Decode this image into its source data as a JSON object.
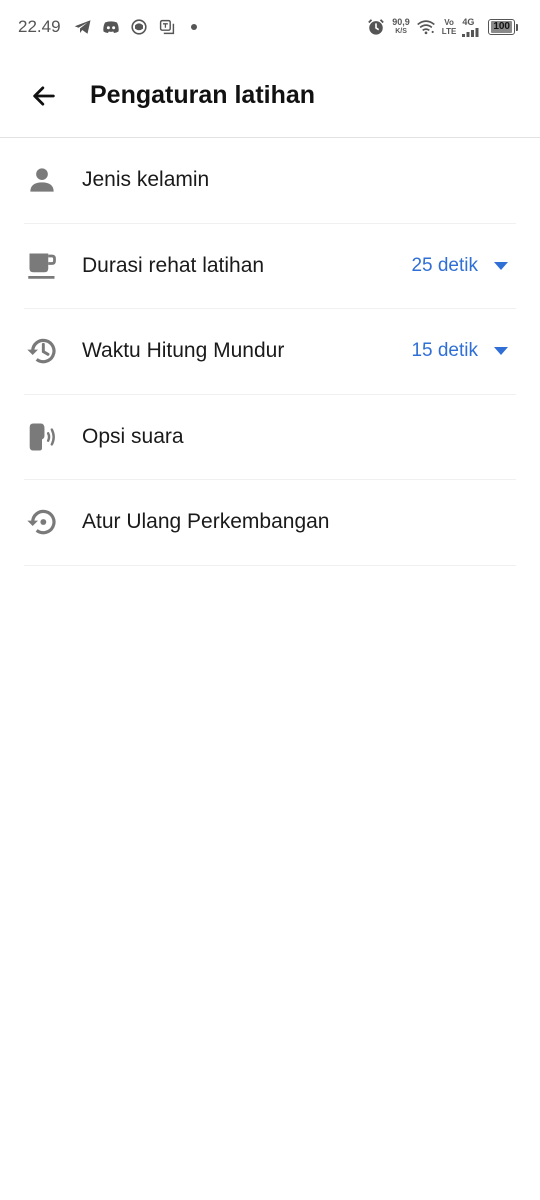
{
  "status_bar": {
    "time": "22.49",
    "net_speed_value": "90,9",
    "net_speed_unit": "K/S",
    "volte_top": "Vo",
    "volte_bottom": "LTE",
    "network_type": "4G",
    "battery": "100",
    "left_icons": [
      "telegram-icon",
      "discord-icon",
      "app-icon",
      "translate-icon"
    ],
    "right_icons": [
      "alarm-icon",
      "wifi-icon",
      "signal-icon"
    ]
  },
  "app_bar": {
    "title": "Pengaturan latihan",
    "back_icon": "arrow-back-icon"
  },
  "settings": [
    {
      "id": "gender",
      "label": "Jenis kelamin",
      "icon": "person-icon",
      "value": ""
    },
    {
      "id": "rest",
      "label": "Durasi rehat latihan",
      "icon": "coffee-cup-icon",
      "value": "25 detik"
    },
    {
      "id": "countdown",
      "label": "Waktu Hitung Mundur",
      "icon": "history-icon",
      "value": "15 detik"
    },
    {
      "id": "voice",
      "label": "Opsi suara",
      "icon": "voice-icon",
      "value": ""
    },
    {
      "id": "reset",
      "label": "Atur Ulang Perkembangan",
      "icon": "reset-icon",
      "value": ""
    }
  ],
  "colors": {
    "accent": "#2f6fd6",
    "icon_gray": "#7a7a7a",
    "divider": "#f0f0f0"
  }
}
